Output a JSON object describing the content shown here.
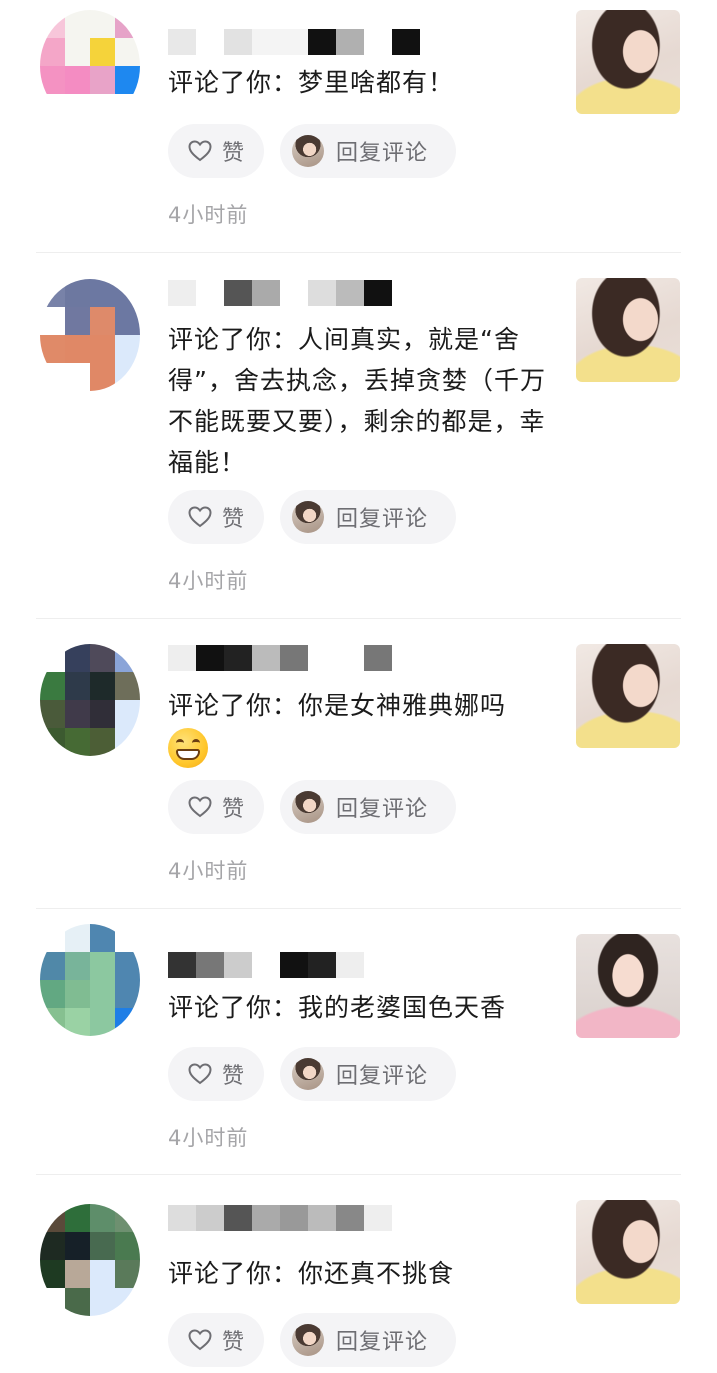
{
  "icons": {
    "like": "heart-outline-icon",
    "reply_avatar": "user-avatar"
  },
  "colors": {
    "pill_background": "#f4f4f6",
    "pill_text": "#6e6e73",
    "time_text": "#a5a5a8",
    "divider": "#eeeeee"
  },
  "notifications": [
    {
      "comment": "评论了你：梦里啥都有！",
      "like_label": "赞",
      "reply_label": "回复评论",
      "time": "4小时前",
      "thumbnail": "yellow",
      "avatar_pixels": [
        "#f7c6da",
        "#f5f5f0",
        "#f5f5f0",
        "#e6a3c8",
        "#f4a6c8",
        "#f5f5f0",
        "#f5d33a",
        "#f5f5f0",
        "#f492c2",
        "#f48cc2",
        "#e8a3c8",
        "#1e88f0",
        "#ffffff",
        "#ffffff",
        "#ffffff",
        "#ffffff"
      ],
      "name_pixels": [
        "#e8e8e8",
        "#ffffff",
        "#e2e2e2",
        "#f4f4f4",
        "#f4f4f4",
        "#111111",
        "#b0b0b0",
        "#ffffff",
        "#111111"
      ]
    },
    {
      "comment": "评论了你：人间真实，就是“舍得”，舍去执念，丢掉贪婪（千万不能既要又要），剩余的都是，幸福能！",
      "like_label": "赞",
      "reply_label": "回复评论",
      "time": "4小时前",
      "thumbnail": "yellow",
      "avatar_pixels": [
        "#7882a8",
        "#6d78a0",
        "#6c78a2",
        "#6c78a2",
        "#ffffff",
        "#7078a0",
        "#de8a6a",
        "#6c78a2",
        "#e08a68",
        "#e08866",
        "#e08866",
        "#dbe9fb",
        "#ffffff",
        "#ffffff",
        "#e08866",
        "#dbe9fb"
      ],
      "name_pixels": [
        "#eeeeee",
        "#ffffff",
        "#555555",
        "#aaaaaa",
        "#ffffff",
        "#dddddd",
        "#bbbbbb",
        "#111111"
      ]
    },
    {
      "comment": "评论了你：你是女神雅典娜吗",
      "like_label": "赞",
      "reply_label": "回复评论",
      "time": "4小时前",
      "thumbnail": "yellow",
      "avatar_pixels": [
        "#ffffff",
        "#36405c",
        "#4f4a5a",
        "#8aa4d8",
        "#3a7a40",
        "#2e3a4a",
        "#1e2a2a",
        "#6e6e5a",
        "#4a5a3a",
        "#403a4a",
        "#302e38",
        "#dbe9fb",
        "#3c5a30",
        "#466a34",
        "#4c5e36",
        "#dbe9fb"
      ],
      "name_pixels": [
        "#eeeeee",
        "#111111",
        "#222222",
        "#bbbbbb",
        "#777777",
        "#ffffff",
        "#ffffff",
        "#777777"
      ]
    },
    {
      "comment": "评论了你：我的老婆国色天香",
      "like_label": "赞",
      "reply_label": "回复评论",
      "time": "4小时前",
      "thumbnail": "pink",
      "avatar_pixels": [
        "#ffffff",
        "#e6f0f6",
        "#4f86b0",
        "#ffffff",
        "#5088a8",
        "#78b49a",
        "#8cc8a0",
        "#4f86b0",
        "#62a882",
        "#80bc92",
        "#8cc8a0",
        "#4f86b0",
        "#86c090",
        "#9ad2a4",
        "#8cc8a0",
        "#1e7ee6"
      ],
      "name_pixels": [
        "#333333",
        "#777777",
        "#cccccc",
        "#ffffff",
        "#111111",
        "#222222",
        "#eeeeee"
      ]
    },
    {
      "comment": "评论了你：你还真不挑食",
      "like_label": "赞",
      "reply_label": "回复评论",
      "time": "",
      "thumbnail": "yellow",
      "avatar_pixels": [
        "#5a4a3a",
        "#2e6e3a",
        "#5e8e6a",
        "#6e9070",
        "#1e2a22",
        "#162028",
        "#486a50",
        "#4a7a50",
        "#1e3a22",
        "#b8a898",
        "#dbe9fb",
        "#5a7a5a",
        "#ffffff",
        "#4a6a4a",
        "#dbe9fb",
        "#dbe9fb"
      ],
      "name_pixels": [
        "#dddddd",
        "#cccccc",
        "#555555",
        "#aaaaaa",
        "#999999",
        "#bbbbbb",
        "#888888",
        "#eeeeee",
        "#ffffff"
      ]
    }
  ]
}
